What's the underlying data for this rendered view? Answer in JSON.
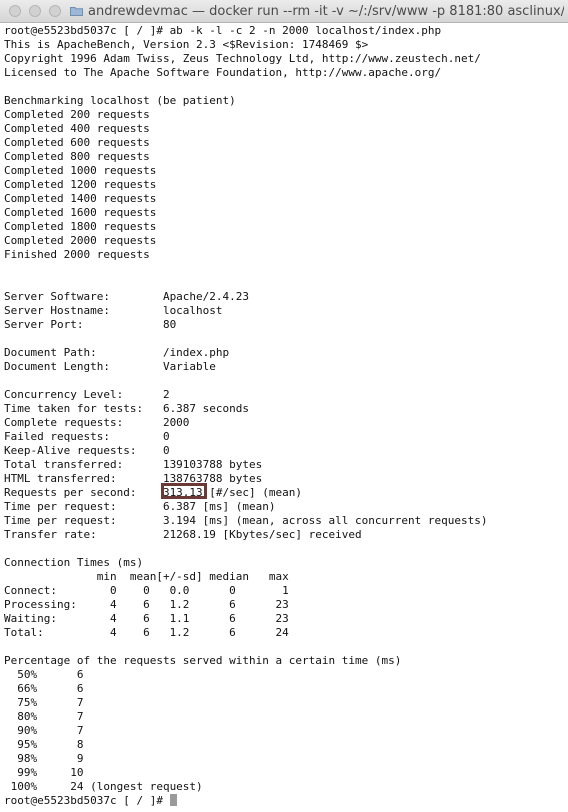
{
  "window": {
    "title": "andrewdevmac — docker run --rm -it -v ~/:/srv/www -p 8181:80 asclinux/mast..."
  },
  "terminal": {
    "lines": [
      "root@e5523bd5037c [ / ]# ab -k -l -c 2 -n 2000 localhost/index.php",
      "This is ApacheBench, Version 2.3 <$Revision: 1748469 $>",
      "Copyright 1996 Adam Twiss, Zeus Technology Ltd, http://www.zeustech.net/",
      "Licensed to The Apache Software Foundation, http://www.apache.org/",
      "",
      "Benchmarking localhost (be patient)",
      "Completed 200 requests",
      "Completed 400 requests",
      "Completed 600 requests",
      "Completed 800 requests",
      "Completed 1000 requests",
      "Completed 1200 requests",
      "Completed 1400 requests",
      "Completed 1600 requests",
      "Completed 1800 requests",
      "Completed 2000 requests",
      "Finished 2000 requests",
      "",
      "",
      "Server Software:        Apache/2.4.23",
      "Server Hostname:        localhost",
      "Server Port:            80",
      "",
      "Document Path:          /index.php",
      "Document Length:        Variable",
      "",
      "Concurrency Level:      2",
      "Time taken for tests:   6.387 seconds",
      "Complete requests:      2000",
      "Failed requests:        0",
      "Keep-Alive requests:    0",
      "Total transferred:      139103788 bytes",
      "HTML transferred:       138763788 bytes",
      "Requests per second:    313.13 [#/sec] (mean)",
      "Time per request:       6.387 [ms] (mean)",
      "Time per request:       3.194 [ms] (mean, across all concurrent requests)",
      "Transfer rate:          21268.19 [Kbytes/sec] received",
      "",
      "Connection Times (ms)",
      "              min  mean[+/-sd] median   max",
      "Connect:        0    0   0.0      0       1",
      "Processing:     4    6   1.2      6      23",
      "Waiting:        4    6   1.1      6      23",
      "Total:          4    6   1.2      6      24",
      "",
      "Percentage of the requests served within a certain time (ms)",
      "  50%      6",
      "  66%      6",
      "  75%      7",
      "  80%      7",
      "  90%      7",
      "  95%      8",
      "  98%      9",
      "  99%     10",
      " 100%     24 (longest request)"
    ],
    "prompt": "root@e5523bd5037c [ / ]# "
  }
}
